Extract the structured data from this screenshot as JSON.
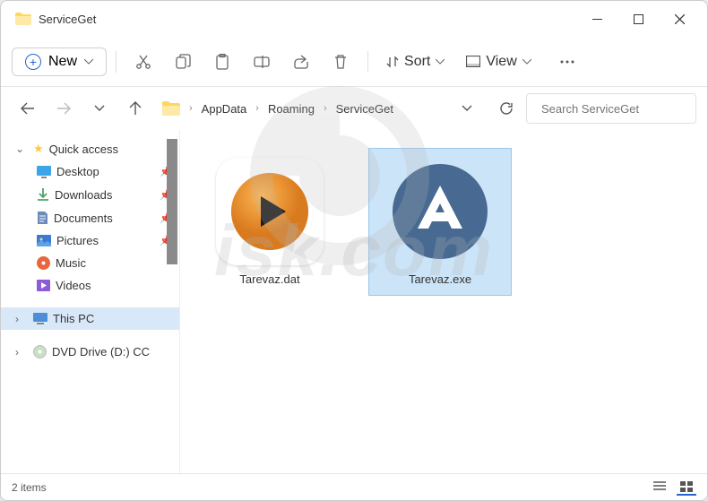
{
  "window": {
    "title": "ServiceGet"
  },
  "toolbar": {
    "new_label": "New",
    "sort_label": "Sort",
    "view_label": "View"
  },
  "breadcrumb": {
    "items": [
      "AppData",
      "Roaming",
      "ServiceGet"
    ]
  },
  "search": {
    "placeholder": "Search ServiceGet"
  },
  "sidebar": {
    "quick_access": "Quick access",
    "items": [
      {
        "label": "Desktop",
        "icon": "desktop"
      },
      {
        "label": "Downloads",
        "icon": "downloads"
      },
      {
        "label": "Documents",
        "icon": "documents"
      },
      {
        "label": "Pictures",
        "icon": "pictures"
      },
      {
        "label": "Music",
        "icon": "music"
      },
      {
        "label": "Videos",
        "icon": "videos"
      }
    ],
    "this_pc": "This PC",
    "dvd": "DVD Drive (D:) CC"
  },
  "files": [
    {
      "name": "Tarevaz.dat",
      "icon": "play"
    },
    {
      "name": "Tarevaz.exe",
      "icon": "autoit",
      "selected": true
    }
  ],
  "statusbar": {
    "count": "2 items"
  },
  "watermark": "isk.com"
}
